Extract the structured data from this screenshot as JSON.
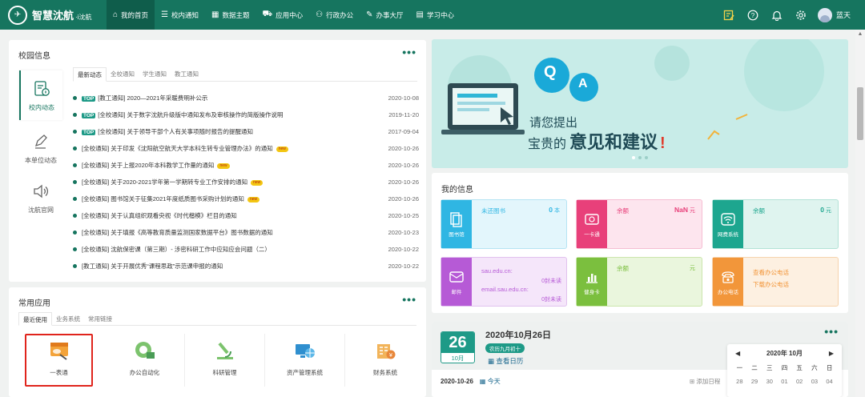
{
  "logo": {
    "title": "智慧沈航",
    "sub": "·i沈航"
  },
  "nav": [
    {
      "icon": "home-icon",
      "glyph": "⌂",
      "label": "我的首页"
    },
    {
      "icon": "list-icon",
      "glyph": "☰",
      "label": "校内通知"
    },
    {
      "icon": "chart-icon",
      "glyph": "▦",
      "label": "数据主题"
    },
    {
      "icon": "cart-icon",
      "glyph": "⛟",
      "label": "应用中心"
    },
    {
      "icon": "person-icon",
      "glyph": "⚇",
      "label": "行政办公"
    },
    {
      "icon": "edit-icon",
      "glyph": "✎",
      "label": "办事大厅"
    },
    {
      "icon": "book-icon",
      "glyph": "▤",
      "label": "学习中心"
    }
  ],
  "user": {
    "name": "蓝天"
  },
  "campus": {
    "title": "校园信息",
    "side_tabs": [
      "校内动态",
      "本单位动态",
      "沈航官网"
    ],
    "news_tabs": [
      "最新动态",
      "全校通知",
      "学生通知",
      "教工通知"
    ],
    "items": [
      {
        "top": true,
        "title": "[教工通知] 2020—2021年采暖费明补公示",
        "date": "2020-10-08",
        "new": false
      },
      {
        "top": true,
        "title": "[全校通知] 关于数字沈航升级版中通知发布及审核操作的简版操作说明",
        "date": "2019-11-20",
        "new": false
      },
      {
        "top": true,
        "title": "[全校通知] 关于领导干部个人有关事项随时报告的提醒通知",
        "date": "2017-09-04",
        "new": false
      },
      {
        "top": false,
        "title": "[全校通知] 关于印发《沈阳航空航天大学本科生转专业管理办法》的通知",
        "date": "2020-10-26",
        "new": true
      },
      {
        "top": false,
        "title": "[全校通知] 关于上报2020年本科教学工作量的通知",
        "date": "2020-10-26",
        "new": true
      },
      {
        "top": false,
        "title": "[全校通知] 关于2020-2021学年第一学期转专业工作安排的通知",
        "date": "2020-10-26",
        "new": true
      },
      {
        "top": false,
        "title": "[全校通知] 图书馆关于征集2021年度纸质图书采购计划的通知",
        "date": "2020-10-26",
        "new": true
      },
      {
        "top": false,
        "title": "[全校通知] 关于认真组织观看央视《时代楷模》栏目的通知",
        "date": "2020-10-25",
        "new": false
      },
      {
        "top": false,
        "title": "[全校通知] 关于填报《高等教育质量监测国家数据平台》图书数据的通知",
        "date": "2020-10-23",
        "new": false
      },
      {
        "top": false,
        "title": "[全校通知] 沈航保密课（第三期）- 涉密科研工作中应知应会问题（二）",
        "date": "2020-10-22",
        "new": false
      },
      {
        "top": false,
        "title": "[教工通知] 关于开展优秀“课程思政”示范课申报的通知",
        "date": "2020-10-22",
        "new": false
      }
    ],
    "new_label": "new",
    "top_label": "TOP"
  },
  "apps": {
    "title": "常用应用",
    "tabs": [
      "最近使用",
      "业务系统",
      "常用链接"
    ],
    "items": [
      "一表通",
      "办公自动化",
      "科研管理",
      "资产管理系统",
      "财务系统"
    ]
  },
  "banner": {
    "q": "Q",
    "a": "A",
    "line1": "请您提出",
    "line2a": "宝贵的",
    "line2b": "意见和建议"
  },
  "myinfo": {
    "title": "我的信息",
    "cards": [
      {
        "label": "图书馆",
        "title": "未还图书",
        "value": "0",
        "unit": "本",
        "color": "#2fb6e3"
      },
      {
        "label": "一卡通",
        "title": "余额",
        "value": "NaN",
        "unit": "元",
        "color": "#e8407a"
      },
      {
        "label": "网费系统",
        "title": "余额",
        "value": "0",
        "unit": "元",
        "color": "#1da68f"
      },
      {
        "label": "邮件",
        "title": "sau.edu.cn:",
        "title2": "email.sau.edu.cn:",
        "right1": "0封未读",
        "right2": "0封未读",
        "color": "#b65ad6"
      },
      {
        "label": "健身卡",
        "title": "余额",
        "unit": "元",
        "color": "#7bbf3e"
      },
      {
        "label": "办公电话",
        "title": "查看办公电话",
        "title2": "下载办公电话",
        "color": "#f2963a"
      }
    ]
  },
  "calendar": {
    "day": "26",
    "month": "10月",
    "date_title": "2020年10月26日",
    "lunar": "农历九月初十",
    "view_label": "查看日历",
    "line_date": "2020-10-26",
    "today": "今天",
    "add": "添加日程",
    "mini": {
      "title": "2020年 10月",
      "weekdays": [
        "一",
        "二",
        "三",
        "四",
        "五",
        "六",
        "日"
      ],
      "days": [
        "28",
        "29",
        "30",
        "01",
        "02",
        "03",
        "04"
      ]
    }
  }
}
